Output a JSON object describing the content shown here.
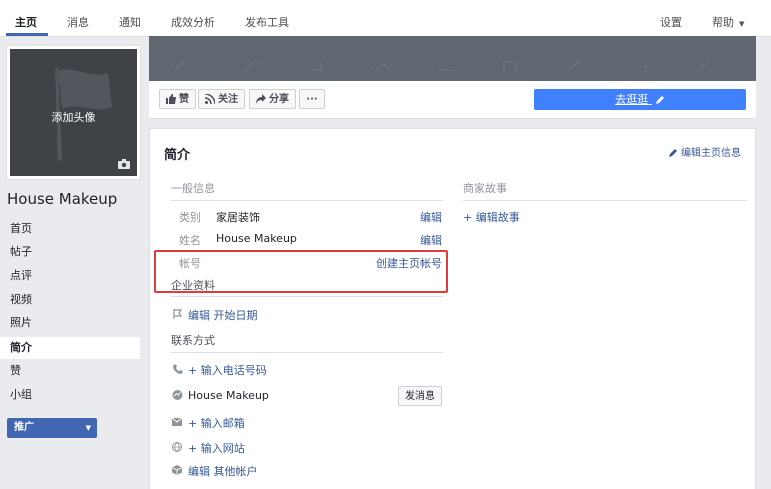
{
  "topnav": {
    "tabs": [
      {
        "label": "主页"
      },
      {
        "label": "消息"
      },
      {
        "label": "通知"
      },
      {
        "label": "成效分析"
      },
      {
        "label": "发布工具"
      }
    ],
    "settings": "设置",
    "help": "帮助"
  },
  "sidebar": {
    "avatar_label": "添加头像",
    "page_name": "House Makeup",
    "items": [
      {
        "label": "首页"
      },
      {
        "label": "帖子"
      },
      {
        "label": "点评"
      },
      {
        "label": "视频"
      },
      {
        "label": "照片"
      },
      {
        "label": "简介"
      },
      {
        "label": "赞"
      },
      {
        "label": "小组"
      }
    ],
    "active_item": "简介",
    "promote": "推广"
  },
  "actions": {
    "like": "赞",
    "follow": "关注",
    "share": "分享",
    "more": "···",
    "visit": "去逛逛"
  },
  "about": {
    "title": "简介",
    "edit_page_info": "编辑主页信息",
    "general_section": "一般信息",
    "category_label": "类别",
    "category_value": "家居装饰",
    "name_label": "姓名",
    "name_value": "House Makeup",
    "edit": "编辑",
    "account_label": "帐号",
    "create_account": "创建主页帐号",
    "business_section": "企业资料",
    "edit_start_date": "编辑 开始日期",
    "contact_section": "联系方式",
    "add_phone": "+ 输入电话号码",
    "messenger_name": "House Makeup",
    "send_message": "发消息",
    "add_email": "+ 输入邮箱",
    "add_website": "+ 输入网站",
    "edit_other_accounts": "编辑 其他帐户",
    "story_section": "商家故事",
    "edit_story": "+ 编辑故事"
  }
}
